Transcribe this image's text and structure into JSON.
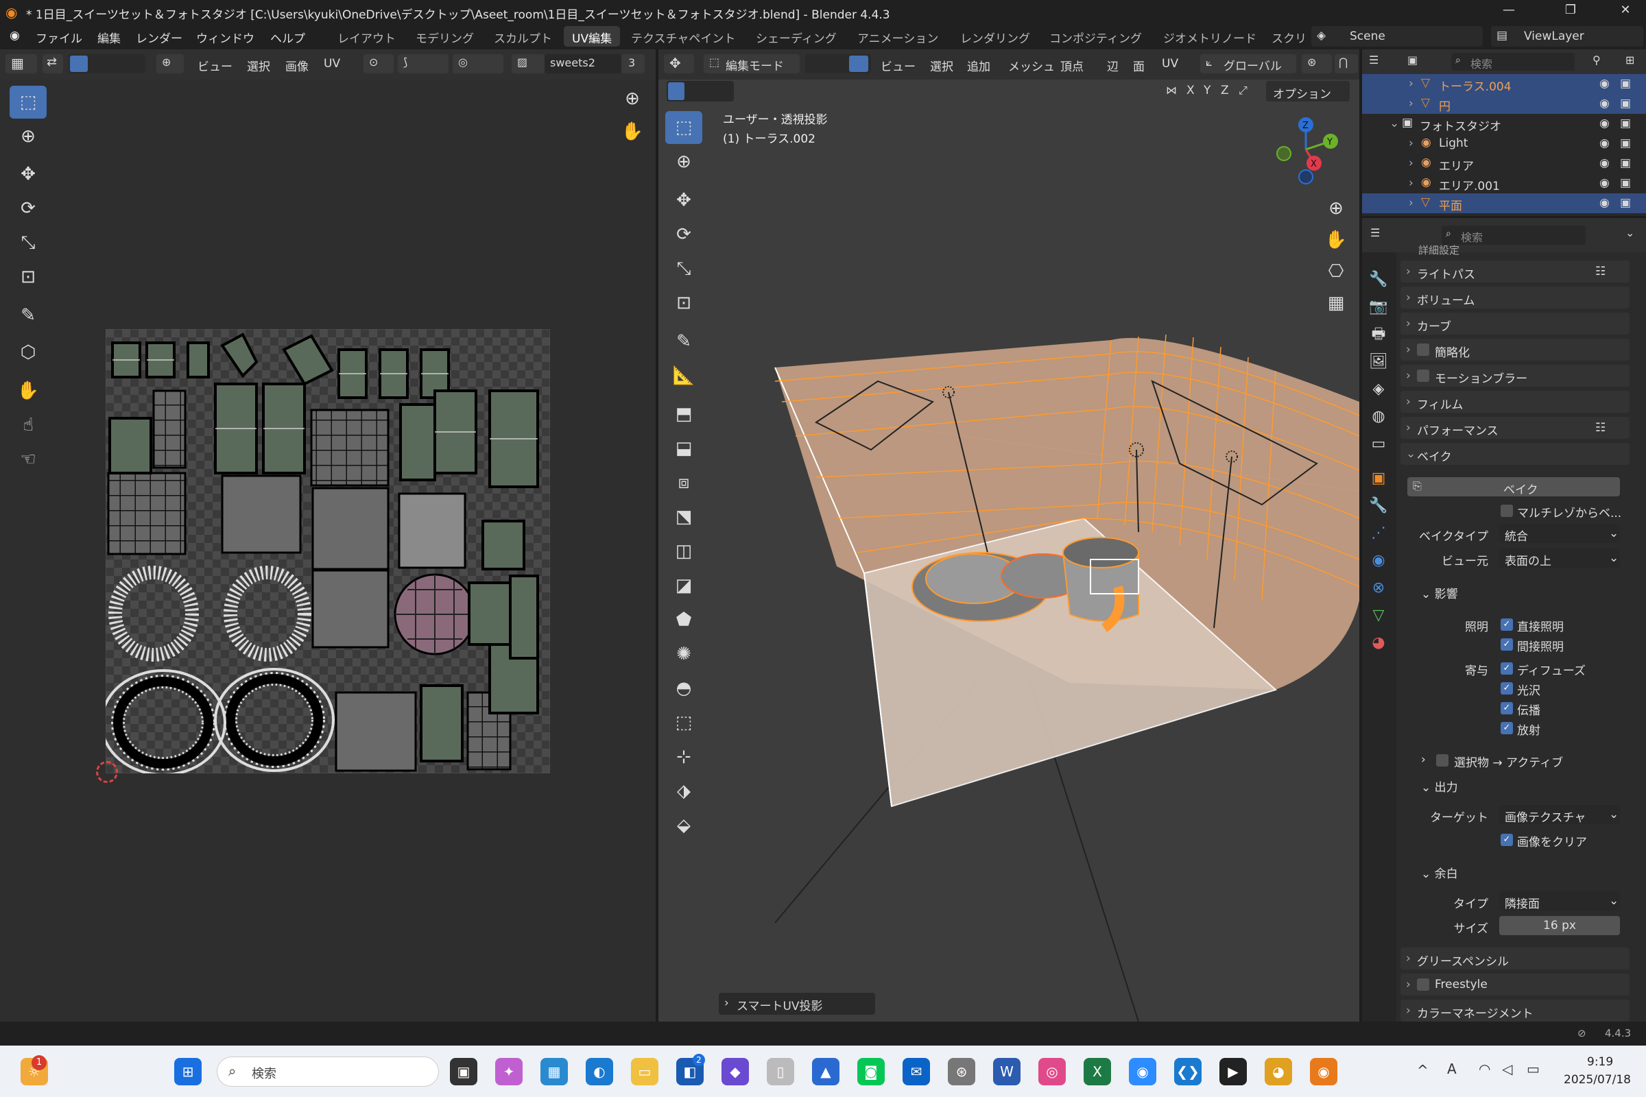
{
  "window": {
    "title": "* 1日目_スイーツセット＆フォトスタジオ [C:\\Users\\kyuki\\OneDrive\\デスクトップ\\Aseet_room\\1日目_スイーツセット＆フォトスタジオ.blend] - Blender 4.4.3"
  },
  "menu": [
    "ファイル",
    "編集",
    "レンダー",
    "ウィンドウ",
    "ヘルプ"
  ],
  "workspaces": [
    "レイアウト",
    "モデリング",
    "スカルプト",
    "UV編集",
    "テクスチャペイント",
    "シェーディング",
    "アニメーション",
    "レンダリング",
    "コンポジティング",
    "ジオメトリノード",
    "スクリ"
  ],
  "scene": "Scene",
  "viewlayer": "ViewLayer",
  "uv": {
    "menus": [
      "ビュー",
      "選択",
      "画像",
      "UV"
    ],
    "image_name": "sweets2",
    "image_users": "3"
  },
  "viewport": {
    "mode": "編集モード",
    "menus": [
      "ビュー",
      "選択",
      "追加",
      "メッシュ",
      "頂点",
      "辺",
      "面",
      "UV"
    ],
    "orientation": "グローバル",
    "options": "オプション",
    "view_name": "ユーザー・透視投影",
    "object_name": "(1) トーラス.002",
    "last_op": "スマートUV投影",
    "axes": [
      "X",
      "Y",
      "Z"
    ]
  },
  "outliner": {
    "search": "検索",
    "rows": [
      {
        "name": "トーラス.004",
        "sel": true,
        "indent": 2,
        "ico": "▽"
      },
      {
        "name": "円",
        "sel": true,
        "indent": 2,
        "ico": "▽"
      },
      {
        "name": "フォトスタジオ",
        "sel": false,
        "indent": 1,
        "ico": "▣"
      },
      {
        "name": "Light",
        "sel": false,
        "indent": 2,
        "ico": "◉"
      },
      {
        "name": "エリア",
        "sel": false,
        "indent": 2,
        "ico": "◉"
      },
      {
        "name": "エリア.001",
        "sel": false,
        "indent": 2,
        "ico": "◉"
      },
      {
        "name": "平面",
        "sel": true,
        "indent": 2,
        "ico": "▽"
      }
    ]
  },
  "props": {
    "search": "検索",
    "cut_top": "詳細設定",
    "sections": [
      "ライトパス",
      "ボリューム",
      "カーブ",
      "簡略化",
      "モーションブラー",
      "フィルム",
      "パフォーマンス",
      "ベイク"
    ],
    "bake_button": "ベイク",
    "multires": "マルチレゾからベ...",
    "bake_type_label": "ベイクタイプ",
    "bake_type": "統合",
    "view_from_label": "ビュー元",
    "view_from": "表面の上",
    "influence": "影響",
    "lighting_label": "照明",
    "direct": "直接照明",
    "indirect": "間接照明",
    "contrib_label": "寄与",
    "diffuse": "ディフューズ",
    "gloss": "光沢",
    "transmission": "伝播",
    "emit": "放射",
    "sel_active": "選択物 → アクティブ",
    "output": "出力",
    "target_label": "ターゲット",
    "target": "画像テクスチャ",
    "clear": "画像をクリア",
    "margin": "余白",
    "type_label": "タイプ",
    "margin_type": "隣接面",
    "size_label": "サイズ",
    "margin_size": "16 px",
    "bottom_sections": [
      "グリースペンシル",
      "Freestyle",
      "カラーマネージメント"
    ]
  },
  "status": {
    "version": "4.4.3"
  },
  "taskbar": {
    "search": "検索",
    "time": "9:19",
    "date": "2025/07/18",
    "badge": "1",
    "ms_badge": "2"
  }
}
